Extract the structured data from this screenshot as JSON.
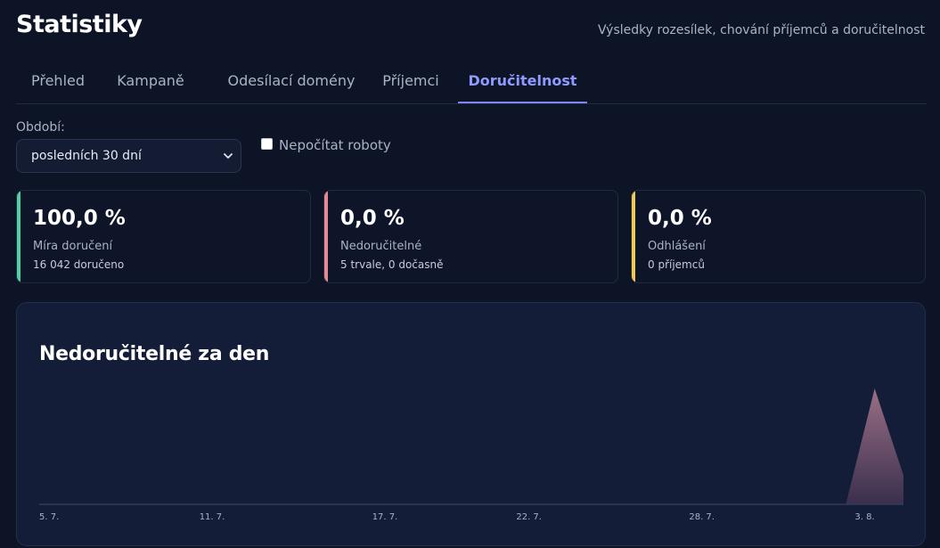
{
  "header": {
    "title": "Statistiky",
    "subtitle": "Výsledky rozesílek, chování příjemců a doručitelnost"
  },
  "tabs": [
    {
      "label": "Přehled",
      "active": false
    },
    {
      "label": "Kampaně",
      "active": false
    },
    {
      "label": "Odesílací domény",
      "active": false
    },
    {
      "label": "Příjemci",
      "active": false
    },
    {
      "label": "Doručitelnost",
      "active": true
    }
  ],
  "filters": {
    "period_label": "Období:",
    "period_value": "posledních 30 dní",
    "robots_label": "Nepočítat roboty",
    "robots_checked": false
  },
  "cards": [
    {
      "value": "100,0 %",
      "label": "Míra doručení",
      "detail": "16 042 doručeno",
      "accent": "#4fd1a5"
    },
    {
      "value": "0,0 %",
      "label": "Nedoručitelné",
      "detail": "5 trvale, 0 dočasně",
      "accent": "#e58a95"
    },
    {
      "value": "0,0 %",
      "label": "Odhlášení",
      "detail": "0 příjemců",
      "accent": "#f2c94c"
    }
  ],
  "chart": {
    "title": "Nedoručitelné za den"
  },
  "chart_data": {
    "type": "area",
    "title": "Nedoručitelné za den",
    "x_ticks": [
      "5. 7.",
      "11. 7.",
      "17. 7.",
      "22. 7.",
      "28. 7.",
      "3. 8."
    ],
    "x": [
      "5. 7.",
      "6. 7.",
      "7. 7.",
      "8. 7.",
      "9. 7.",
      "10. 7.",
      "11. 7.",
      "12. 7.",
      "13. 7.",
      "14. 7.",
      "15. 7.",
      "16. 7.",
      "17. 7.",
      "18. 7.",
      "19. 7.",
      "20. 7.",
      "21. 7.",
      "22. 7.",
      "23. 7.",
      "24. 7.",
      "25. 7.",
      "26. 7.",
      "27. 7.",
      "28. 7.",
      "29. 7.",
      "30. 7.",
      "31. 7.",
      "1. 8.",
      "2. 8.",
      "3. 8.",
      "4. 8."
    ],
    "series": [
      {
        "values": [
          0,
          0,
          0,
          0,
          0,
          0,
          0,
          0,
          0,
          0,
          0,
          0,
          0,
          0,
          0,
          0,
          0,
          0,
          0,
          0,
          0,
          0,
          0,
          0,
          0,
          0,
          0,
          0,
          0,
          4,
          1
        ]
      }
    ],
    "colors": {
      "area_top": "#9a6f86",
      "area_bottom": "#3a2f4d",
      "baseline": "#323c57"
    }
  }
}
